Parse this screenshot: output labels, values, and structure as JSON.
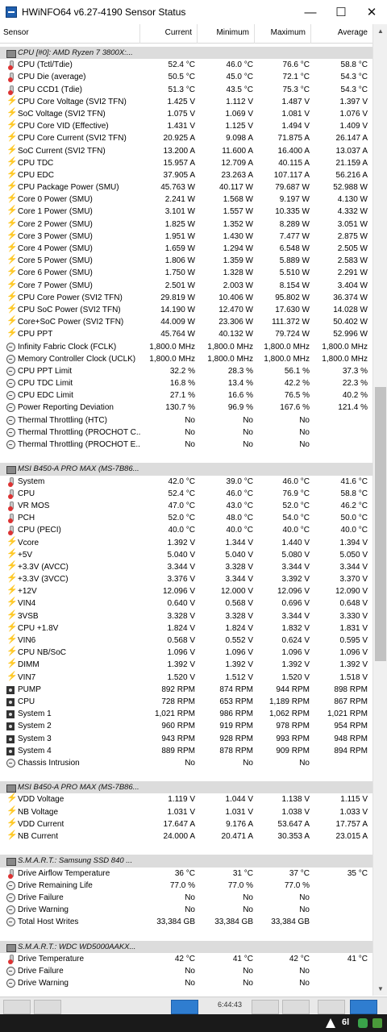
{
  "window": {
    "title": "HWiNFO64 v6.27-4190 Sensor Status",
    "minimize_glyph": "—",
    "maximize_glyph": "☐",
    "close_glyph": "✕"
  },
  "columns": {
    "sensor": "Sensor",
    "current": "Current",
    "minimum": "Minimum",
    "maximum": "Maximum",
    "average": "Average"
  },
  "rows": [
    {
      "type": "group",
      "name": "CPU [#0]: AMD Ryzen 7 3800X:..."
    },
    {
      "icon": "thermo",
      "name": "CPU (Tctl/Tdie)",
      "cur": "52.4 °C",
      "min": "46.0 °C",
      "max": "76.6 °C",
      "avg": "58.8 °C"
    },
    {
      "icon": "thermo",
      "name": "CPU Die (average)",
      "cur": "50.5 °C",
      "min": "45.0 °C",
      "max": "72.1 °C",
      "avg": "54.3 °C"
    },
    {
      "icon": "thermo",
      "name": "CPU CCD1 (Tdie)",
      "cur": "51.3 °C",
      "min": "43.5 °C",
      "max": "75.3 °C",
      "avg": "54.3 °C"
    },
    {
      "icon": "bolt",
      "name": "CPU Core Voltage (SVI2 TFN)",
      "cur": "1.425 V",
      "min": "1.112 V",
      "max": "1.487 V",
      "avg": "1.397 V"
    },
    {
      "icon": "bolt",
      "name": "SoC Voltage (SVI2 TFN)",
      "cur": "1.075 V",
      "min": "1.069 V",
      "max": "1.081 V",
      "avg": "1.076 V"
    },
    {
      "icon": "bolt",
      "name": "CPU Core VID (Effective)",
      "cur": "1.431 V",
      "min": "1.125 V",
      "max": "1.494 V",
      "avg": "1.409 V"
    },
    {
      "icon": "bolt",
      "name": "CPU Core Current (SVI2 TFN)",
      "cur": "20.925 A",
      "min": "9.098 A",
      "max": "71.875 A",
      "avg": "26.147 A"
    },
    {
      "icon": "bolt",
      "name": "SoC Current (SVI2 TFN)",
      "cur": "13.200 A",
      "min": "11.600 A",
      "max": "16.400 A",
      "avg": "13.037 A"
    },
    {
      "icon": "bolt",
      "name": "CPU TDC",
      "cur": "15.957 A",
      "min": "12.709 A",
      "max": "40.115 A",
      "avg": "21.159 A"
    },
    {
      "icon": "bolt",
      "name": "CPU EDC",
      "cur": "37.905 A",
      "min": "23.263 A",
      "max": "107.117 A",
      "avg": "56.216 A"
    },
    {
      "icon": "bolt",
      "name": "CPU Package Power (SMU)",
      "cur": "45.763 W",
      "min": "40.117 W",
      "max": "79.687 W",
      "avg": "52.988 W"
    },
    {
      "icon": "bolt",
      "name": "Core 0 Power (SMU)",
      "cur": "2.241 W",
      "min": "1.568 W",
      "max": "9.197 W",
      "avg": "4.130 W"
    },
    {
      "icon": "bolt",
      "name": "Core 1 Power (SMU)",
      "cur": "3.101 W",
      "min": "1.557 W",
      "max": "10.335 W",
      "avg": "4.332 W"
    },
    {
      "icon": "bolt",
      "name": "Core 2 Power (SMU)",
      "cur": "1.825 W",
      "min": "1.352 W",
      "max": "8.289 W",
      "avg": "3.051 W"
    },
    {
      "icon": "bolt",
      "name": "Core 3 Power (SMU)",
      "cur": "1.951 W",
      "min": "1.430 W",
      "max": "7.477 W",
      "avg": "2.875 W"
    },
    {
      "icon": "bolt",
      "name": "Core 4 Power (SMU)",
      "cur": "1.659 W",
      "min": "1.294 W",
      "max": "6.548 W",
      "avg": "2.505 W"
    },
    {
      "icon": "bolt",
      "name": "Core 5 Power (SMU)",
      "cur": "1.806 W",
      "min": "1.359 W",
      "max": "5.889 W",
      "avg": "2.583 W"
    },
    {
      "icon": "bolt",
      "name": "Core 6 Power (SMU)",
      "cur": "1.750 W",
      "min": "1.328 W",
      "max": "5.510 W",
      "avg": "2.291 W"
    },
    {
      "icon": "bolt",
      "name": "Core 7 Power (SMU)",
      "cur": "2.501 W",
      "min": "2.003 W",
      "max": "8.154 W",
      "avg": "3.404 W"
    },
    {
      "icon": "bolt",
      "name": "CPU Core Power (SVI2 TFN)",
      "cur": "29.819 W",
      "min": "10.406 W",
      "max": "95.802 W",
      "avg": "36.374 W"
    },
    {
      "icon": "bolt",
      "name": "CPU SoC Power (SVI2 TFN)",
      "cur": "14.190 W",
      "min": "12.470 W",
      "max": "17.630 W",
      "avg": "14.028 W"
    },
    {
      "icon": "bolt",
      "name": "Core+SoC Power (SVI2 TFN)",
      "cur": "44.009 W",
      "min": "23.306 W",
      "max": "111.372 W",
      "avg": "50.402 W"
    },
    {
      "icon": "bolt",
      "name": "CPU PPT",
      "cur": "45.764 W",
      "min": "40.132 W",
      "max": "79.724 W",
      "avg": "52.996 W"
    },
    {
      "icon": "clock",
      "name": "Infinity Fabric Clock (FCLK)",
      "cur": "1,800.0 MHz",
      "min": "1,800.0 MHz",
      "max": "1,800.0 MHz",
      "avg": "1,800.0 MHz"
    },
    {
      "icon": "clock",
      "name": "Memory Controller Clock (UCLK)",
      "cur": "1,800.0 MHz",
      "min": "1,800.0 MHz",
      "max": "1,800.0 MHz",
      "avg": "1,800.0 MHz"
    },
    {
      "icon": "clock",
      "name": "CPU PPT Limit",
      "cur": "32.2 %",
      "min": "28.3 %",
      "max": "56.1 %",
      "avg": "37.3 %"
    },
    {
      "icon": "clock",
      "name": "CPU TDC Limit",
      "cur": "16.8 %",
      "min": "13.4 %",
      "max": "42.2 %",
      "avg": "22.3 %"
    },
    {
      "icon": "clock",
      "name": "CPU EDC Limit",
      "cur": "27.1 %",
      "min": "16.6 %",
      "max": "76.5 %",
      "avg": "40.2 %"
    },
    {
      "icon": "clock",
      "name": "Power Reporting Deviation",
      "cur": "130.7 %",
      "min": "96.9 %",
      "max": "167.6 %",
      "avg": "121.4 %"
    },
    {
      "icon": "clock",
      "name": "Thermal Throttling (HTC)",
      "cur": "No",
      "min": "No",
      "max": "No",
      "avg": ""
    },
    {
      "icon": "clock",
      "name": "Thermal Throttling (PROCHOT C...",
      "cur": "No",
      "min": "No",
      "max": "No",
      "avg": ""
    },
    {
      "icon": "clock",
      "name": "Thermal Throttling (PROCHOT E...",
      "cur": "No",
      "min": "No",
      "max": "No",
      "avg": ""
    },
    {
      "type": "spacer"
    },
    {
      "type": "group",
      "name": "MSI B450-A PRO MAX (MS-7B86..."
    },
    {
      "icon": "thermo",
      "name": "System",
      "cur": "42.0 °C",
      "min": "39.0 °C",
      "max": "46.0 °C",
      "avg": "41.6 °C"
    },
    {
      "icon": "thermo",
      "name": "CPU",
      "cur": "52.4 °C",
      "min": "46.0 °C",
      "max": "76.9 °C",
      "avg": "58.8 °C"
    },
    {
      "icon": "thermo",
      "name": "VR MOS",
      "cur": "47.0 °C",
      "min": "43.0 °C",
      "max": "52.0 °C",
      "avg": "46.2 °C"
    },
    {
      "icon": "thermo",
      "name": "PCH",
      "cur": "52.0 °C",
      "min": "48.0 °C",
      "max": "54.0 °C",
      "avg": "50.0 °C"
    },
    {
      "icon": "thermo",
      "name": "CPU (PECI)",
      "cur": "40.0 °C",
      "min": "40.0 °C",
      "max": "40.0 °C",
      "avg": "40.0 °C"
    },
    {
      "icon": "bolt",
      "name": "Vcore",
      "cur": "1.392 V",
      "min": "1.344 V",
      "max": "1.440 V",
      "avg": "1.394 V"
    },
    {
      "icon": "bolt",
      "name": "+5V",
      "cur": "5.040 V",
      "min": "5.040 V",
      "max": "5.080 V",
      "avg": "5.050 V"
    },
    {
      "icon": "bolt",
      "name": "+3.3V (AVCC)",
      "cur": "3.344 V",
      "min": "3.328 V",
      "max": "3.344 V",
      "avg": "3.344 V"
    },
    {
      "icon": "bolt",
      "name": "+3.3V (3VCC)",
      "cur": "3.376 V",
      "min": "3.344 V",
      "max": "3.392 V",
      "avg": "3.370 V"
    },
    {
      "icon": "bolt",
      "name": "+12V",
      "cur": "12.096 V",
      "min": "12.000 V",
      "max": "12.096 V",
      "avg": "12.090 V"
    },
    {
      "icon": "bolt",
      "name": "VIN4",
      "cur": "0.640 V",
      "min": "0.568 V",
      "max": "0.696 V",
      "avg": "0.648 V"
    },
    {
      "icon": "bolt",
      "name": "3VSB",
      "cur": "3.328 V",
      "min": "3.328 V",
      "max": "3.344 V",
      "avg": "3.330 V"
    },
    {
      "icon": "bolt",
      "name": "CPU +1.8V",
      "cur": "1.824 V",
      "min": "1.824 V",
      "max": "1.832 V",
      "avg": "1.831 V"
    },
    {
      "icon": "bolt",
      "name": "VIN6",
      "cur": "0.568 V",
      "min": "0.552 V",
      "max": "0.624 V",
      "avg": "0.595 V"
    },
    {
      "icon": "bolt",
      "name": "CPU NB/SoC",
      "cur": "1.096 V",
      "min": "1.096 V",
      "max": "1.096 V",
      "avg": "1.096 V"
    },
    {
      "icon": "bolt",
      "name": "DIMM",
      "cur": "1.392 V",
      "min": "1.392 V",
      "max": "1.392 V",
      "avg": "1.392 V"
    },
    {
      "icon": "bolt",
      "name": "VIN7",
      "cur": "1.520 V",
      "min": "1.512 V",
      "max": "1.520 V",
      "avg": "1.518 V"
    },
    {
      "icon": "fan",
      "name": "PUMP",
      "cur": "892 RPM",
      "min": "874 RPM",
      "max": "944 RPM",
      "avg": "898 RPM"
    },
    {
      "icon": "fan",
      "name": "CPU",
      "cur": "728 RPM",
      "min": "653 RPM",
      "max": "1,189 RPM",
      "avg": "867 RPM"
    },
    {
      "icon": "fan",
      "name": "System 1",
      "cur": "1,021 RPM",
      "min": "986 RPM",
      "max": "1,062 RPM",
      "avg": "1,021 RPM"
    },
    {
      "icon": "fan",
      "name": "System 2",
      "cur": "960 RPM",
      "min": "919 RPM",
      "max": "978 RPM",
      "avg": "954 RPM"
    },
    {
      "icon": "fan",
      "name": "System 3",
      "cur": "943 RPM",
      "min": "928 RPM",
      "max": "993 RPM",
      "avg": "948 RPM"
    },
    {
      "icon": "fan",
      "name": "System 4",
      "cur": "889 RPM",
      "min": "878 RPM",
      "max": "909 RPM",
      "avg": "894 RPM"
    },
    {
      "icon": "clock",
      "name": "Chassis Intrusion",
      "cur": "No",
      "min": "No",
      "max": "No",
      "avg": ""
    },
    {
      "type": "spacer"
    },
    {
      "type": "group",
      "name": "MSI B450-A PRO MAX (MS-7B86..."
    },
    {
      "icon": "bolt",
      "name": "VDD Voltage",
      "cur": "1.119 V",
      "min": "1.044 V",
      "max": "1.138 V",
      "avg": "1.115 V"
    },
    {
      "icon": "bolt",
      "name": "NB Voltage",
      "cur": "1.031 V",
      "min": "1.031 V",
      "max": "1.038 V",
      "avg": "1.033 V"
    },
    {
      "icon": "bolt",
      "name": "VDD Current",
      "cur": "17.647 A",
      "min": "9.176 A",
      "max": "53.647 A",
      "avg": "17.757 A"
    },
    {
      "icon": "bolt",
      "name": "NB Current",
      "cur": "24.000 A",
      "min": "20.471 A",
      "max": "30.353 A",
      "avg": "23.015 A"
    },
    {
      "type": "spacer"
    },
    {
      "type": "group",
      "name": "S.M.A.R.T.: Samsung SSD 840 ..."
    },
    {
      "icon": "thermo",
      "name": "Drive Airflow Temperature",
      "cur": "36 °C",
      "min": "31 °C",
      "max": "37 °C",
      "avg": "35 °C"
    },
    {
      "icon": "clock",
      "name": "Drive Remaining Life",
      "cur": "77.0 %",
      "min": "77.0 %",
      "max": "77.0 %",
      "avg": ""
    },
    {
      "icon": "clock",
      "name": "Drive Failure",
      "cur": "No",
      "min": "No",
      "max": "No",
      "avg": ""
    },
    {
      "icon": "clock",
      "name": "Drive Warning",
      "cur": "No",
      "min": "No",
      "max": "No",
      "avg": ""
    },
    {
      "icon": "clock",
      "name": "Total Host Writes",
      "cur": "33,384 GB",
      "min": "33,384 GB",
      "max": "33,384 GB",
      "avg": ""
    },
    {
      "type": "spacer"
    },
    {
      "type": "group",
      "name": "S.M.A.R.T.: WDC WD5000AAKX..."
    },
    {
      "icon": "thermo",
      "name": "Drive Temperature",
      "cur": "42 °C",
      "min": "41 °C",
      "max": "42 °C",
      "avg": "41 °C"
    },
    {
      "icon": "clock",
      "name": "Drive Failure",
      "cur": "No",
      "min": "No",
      "max": "No",
      "avg": ""
    },
    {
      "icon": "clock",
      "name": "Drive Warning",
      "cur": "No",
      "min": "No",
      "max": "No",
      "avg": ""
    }
  ],
  "toolbar": {
    "timer_text": "6:44:43"
  },
  "taskbar": {
    "tray_text": "6l"
  },
  "colors": {
    "group_bg": "#dcdcdc",
    "accent_blue": "#2f7dd0",
    "bolt_yellow": "#e6b800",
    "thermo_red": "#dd3333"
  }
}
